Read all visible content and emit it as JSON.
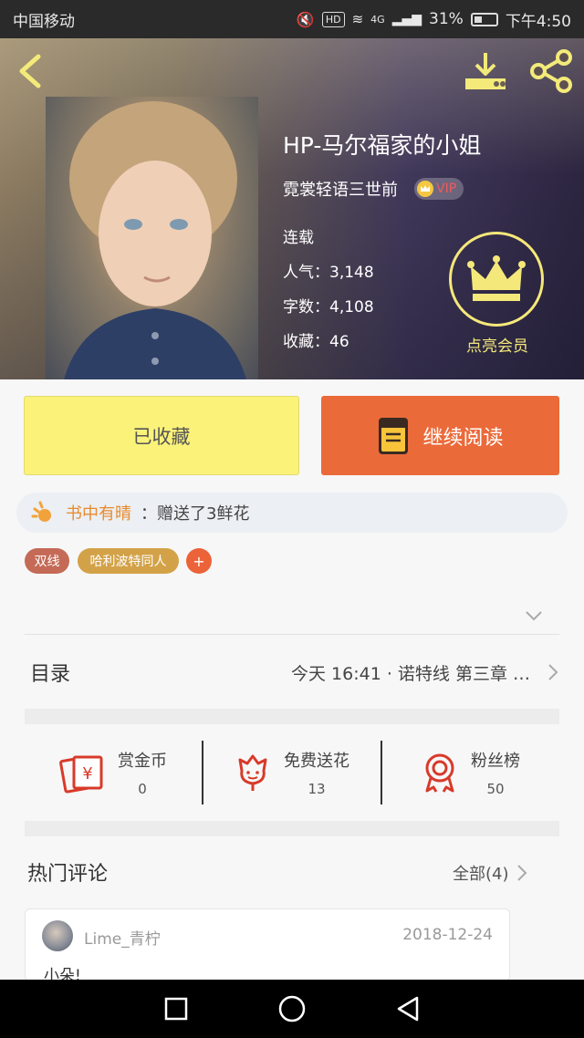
{
  "status_bar": {
    "carrier": "中国移动",
    "hd": "HD",
    "network": "4G",
    "battery": "31%",
    "time": "下午4:50"
  },
  "book": {
    "title": "HP-马尔福家的小姐",
    "author": "霓裳轻语三世前",
    "vip": "VIP",
    "status": "连载",
    "popularity": "人气：3,148",
    "word_count": "字数：4,108",
    "favorites": "收藏：46"
  },
  "membership": {
    "label": "点亮会员"
  },
  "actions": {
    "collected": "已收藏",
    "continue_reading": "继续阅读"
  },
  "sun": {
    "label": "书中有晴",
    "text": "：赠送了3鲜花"
  },
  "tags": [
    "双线",
    "哈利波特同人",
    "+"
  ],
  "catalog": {
    "title": "目录",
    "latest": "今天 16:41 · 诺特线 第三章 …"
  },
  "stats": [
    {
      "label": "赏金币",
      "value": "0"
    },
    {
      "label": "免费送花",
      "value": "13"
    },
    {
      "label": "粉丝榜",
      "value": "50"
    }
  ],
  "comments": {
    "title": "热门评论",
    "all": "全部(4)",
    "items": [
      {
        "user": "Lime_青柠",
        "date": "2018-12-24",
        "text": "小朵!"
      }
    ]
  },
  "colors": {
    "accent_orange": "#eb6a3a",
    "collected_yellow": "#fbf27a",
    "crown_yellow": "#f5e87a"
  }
}
